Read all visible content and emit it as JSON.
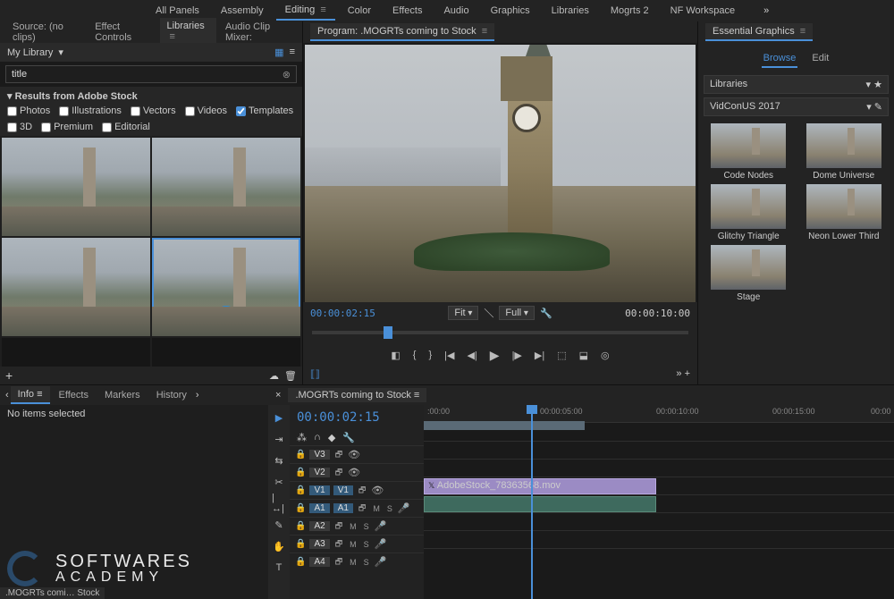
{
  "workspace": {
    "items": [
      "All Panels",
      "Assembly",
      "Editing",
      "Color",
      "Effects",
      "Audio",
      "Graphics",
      "Libraries",
      "Mogrts 2",
      "NF Workspace"
    ],
    "active": 2
  },
  "source_tabs": {
    "source": "Source: (no clips)",
    "effect": "Effect Controls",
    "libraries": "Libraries",
    "audio": "Audio Clip Mixer:"
  },
  "library": {
    "name": "My Library",
    "search_value": "title",
    "stock_header": "Results from Adobe Stock",
    "filters": {
      "photos": "Photos",
      "illustrations": "Illustrations",
      "vectors": "Vectors",
      "videos": "Videos",
      "templates": "Templates",
      "threeD": "3D",
      "premium": "Premium",
      "editorial": "Editorial"
    }
  },
  "program": {
    "title": "Program: .MOGRTs coming to Stock",
    "tc_in": "00:00:02:15",
    "tc_out": "00:00:10:00",
    "fit": "Fit",
    "quality": "Full"
  },
  "eg": {
    "title": "Essential Graphics",
    "tabs": {
      "browse": "Browse",
      "edit": "Edit"
    },
    "dd1": "Libraries",
    "dd2": "VidConUS 2017",
    "items": [
      "Code Nodes",
      "Dome Universe",
      "Glitchy Triangle",
      "Neon Lower Third",
      "Stage"
    ]
  },
  "info": {
    "tabs": {
      "info": "Info",
      "effects": "Effects",
      "markers": "Markers",
      "history": "History"
    },
    "none": "No items selected"
  },
  "watermark": {
    "top": "SOFTWARES",
    "bottom": "ACADEMY"
  },
  "seq_footer": ".MOGRTs comi…  Stock",
  "timeline": {
    "seq": ".MOGRTs coming to Stock",
    "tc": "00:00:02:15",
    "ruler": [
      ":00:00",
      "00:00:05:00",
      "00:00:10:00",
      "00:00:15:00",
      "00:00"
    ],
    "video_tracks": [
      "V3",
      "V2",
      "V1"
    ],
    "audio_tracks": [
      "A1",
      "A2",
      "A3",
      "A4"
    ],
    "clip_label": "AdobeStock_78363568.mov"
  }
}
